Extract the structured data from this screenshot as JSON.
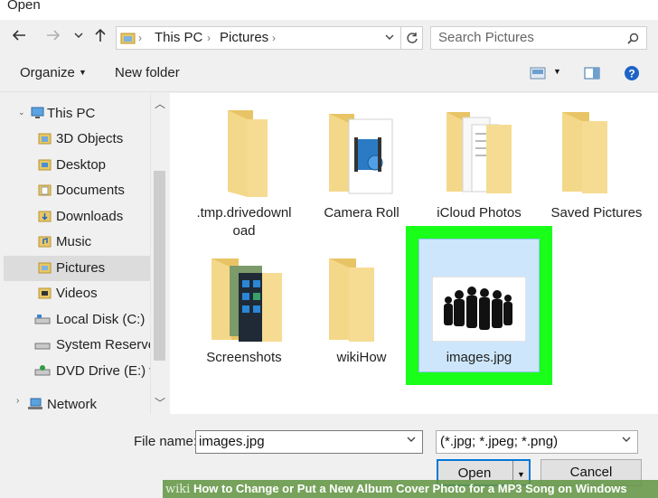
{
  "window": {
    "title": "Open"
  },
  "nav": {
    "back_icon": "arrow-left-icon",
    "forward_icon": "arrow-right-icon",
    "recent_icon": "chevron-down-icon",
    "up_icon": "arrow-up-icon"
  },
  "address": {
    "crumbs": [
      "This PC",
      "Pictures"
    ]
  },
  "search": {
    "placeholder": "Search Pictures"
  },
  "toolbar": {
    "organize_label": "Organize",
    "new_folder_label": "New folder"
  },
  "sidebar": {
    "items": [
      {
        "label": "This PC",
        "icon": "computer-icon"
      },
      {
        "label": "3D Objects",
        "icon": "folder-icon"
      },
      {
        "label": "Desktop",
        "icon": "folder-icon"
      },
      {
        "label": "Documents",
        "icon": "folder-icon"
      },
      {
        "label": "Downloads",
        "icon": "folder-icon"
      },
      {
        "label": "Music",
        "icon": "folder-icon"
      },
      {
        "label": "Pictures",
        "icon": "folder-icon",
        "selected": true
      },
      {
        "label": "Videos",
        "icon": "folder-icon"
      },
      {
        "label": "Local Disk (C:)",
        "icon": "drive-icon"
      },
      {
        "label": "System Reserved",
        "icon": "drive-icon"
      },
      {
        "label": "DVD Drive (E:) w",
        "icon": "dvd-drive-icon"
      },
      {
        "label": "Network",
        "icon": "network-icon"
      }
    ]
  },
  "files": [
    {
      "name": ".tmp.drivedownl",
      "name2": "oad",
      "type": "folder"
    },
    {
      "name": "Camera Roll",
      "type": "folder"
    },
    {
      "name": "iCloud Photos",
      "type": "folder"
    },
    {
      "name": "Saved Pictures",
      "type": "folder"
    },
    {
      "name": "Screenshots",
      "type": "folder"
    },
    {
      "name": "wikiHow",
      "type": "folder"
    },
    {
      "name": "images.jpg",
      "type": "image",
      "selected": true
    }
  ],
  "footer": {
    "filename_label": "File name:",
    "filename_value": "images.jpg",
    "filetype_value": "(*.jpg; *.jpeg; *.png)",
    "open_label": "Open",
    "cancel_label": "Cancel"
  },
  "watermark": {
    "brand": "wiki",
    "text": "How to Change or Put a New Album Cover Photo for a MP3 Song on Windows"
  },
  "colors": {
    "highlight": "#1aff1a",
    "folder": "#f3d27a",
    "accent": "#0078d7"
  }
}
